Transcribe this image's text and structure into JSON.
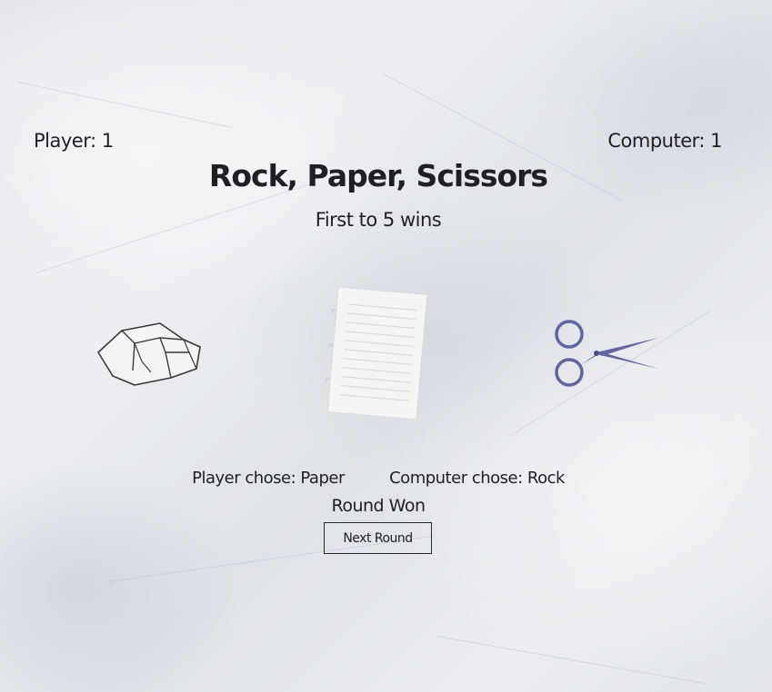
{
  "scoreboard": {
    "player_score": "Player: 1",
    "computer_score": "Computer: 1"
  },
  "title": "Rock, Paper, Scissors",
  "subtitle": "First to 5 wins",
  "choices": {
    "rock_icon": "rock-icon",
    "paper_icon": "paper-icon",
    "scissors_icon": "scissors-icon"
  },
  "results": {
    "player_choice": "Player chose: Paper",
    "computer_choice": "Computer chose: Rock",
    "round_result": "Round Won"
  },
  "controls": {
    "next_round_label": "Next Round"
  },
  "colors": {
    "scissors": "#5f66a0",
    "text": "#1f1f24",
    "background": "#e6e8eb"
  }
}
